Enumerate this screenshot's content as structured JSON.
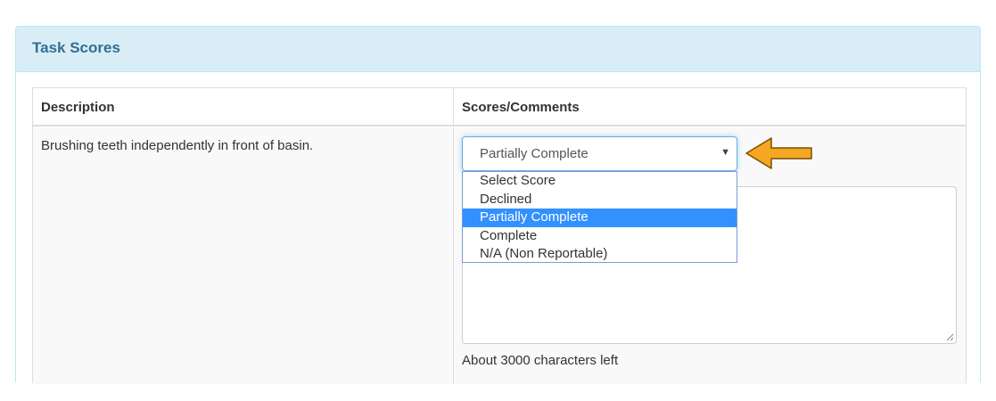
{
  "panel": {
    "title": "Task Scores"
  },
  "table": {
    "headers": {
      "description": "Description",
      "scores": "Scores/Comments"
    },
    "rows": [
      {
        "description": "Brushing teeth independently in front of basin.",
        "score_selected": "Partially Complete",
        "score_options": [
          "Select Score",
          "Declined",
          "Partially Complete",
          "Complete",
          "N/A (Non Reportable)"
        ],
        "comment_value": "",
        "chars_left": "About 3000 characters left"
      }
    ]
  },
  "colors": {
    "panel_heading_bg": "#d9edf7",
    "panel_title": "#31708f",
    "option_highlight": "#3390ff",
    "arrow_fill": "#f5a623"
  },
  "icons": {
    "select_caret": "caret-down-icon",
    "annotation": "arrow-left-icon"
  }
}
